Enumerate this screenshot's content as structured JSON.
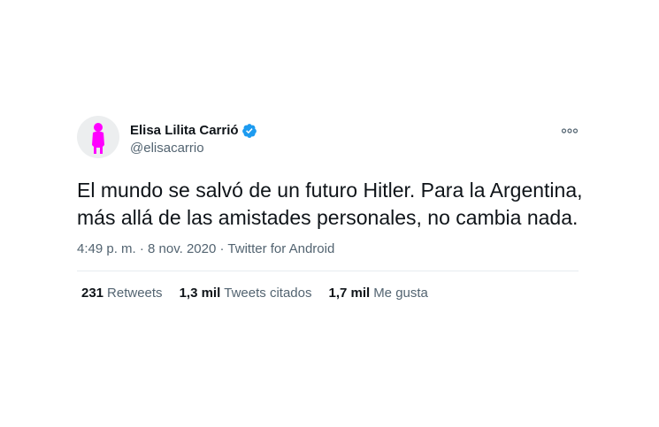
{
  "author": {
    "display_name": "Elisa Lilita Carrió",
    "handle": "@elisacarrio",
    "verified": true
  },
  "tweet": {
    "text": "El mundo se salvó de un futuro Hitler. Para la Argentina,\nmás allá de las amistades personales, no cambia nada."
  },
  "meta": {
    "time": "4:49 p. m.",
    "separator": "·",
    "date": "8 nov. 2020",
    "source": "Twitter for Android"
  },
  "stats": [
    {
      "count": "231",
      "label": "Retweets"
    },
    {
      "count": "1,3 mil",
      "label": "Tweets citados"
    },
    {
      "count": "1,7 mil",
      "label": "Me gusta"
    }
  ],
  "icons": {
    "verified": "verified-badge-icon",
    "more": "more-options-icon",
    "avatar": "profile-silhouette"
  },
  "colors": {
    "verified_blue": "#1d9bf0",
    "avatar_figure": "#ff00ff",
    "avatar_bg": "#eceeef",
    "text_primary": "#0f1419",
    "text_secondary": "#536471"
  }
}
